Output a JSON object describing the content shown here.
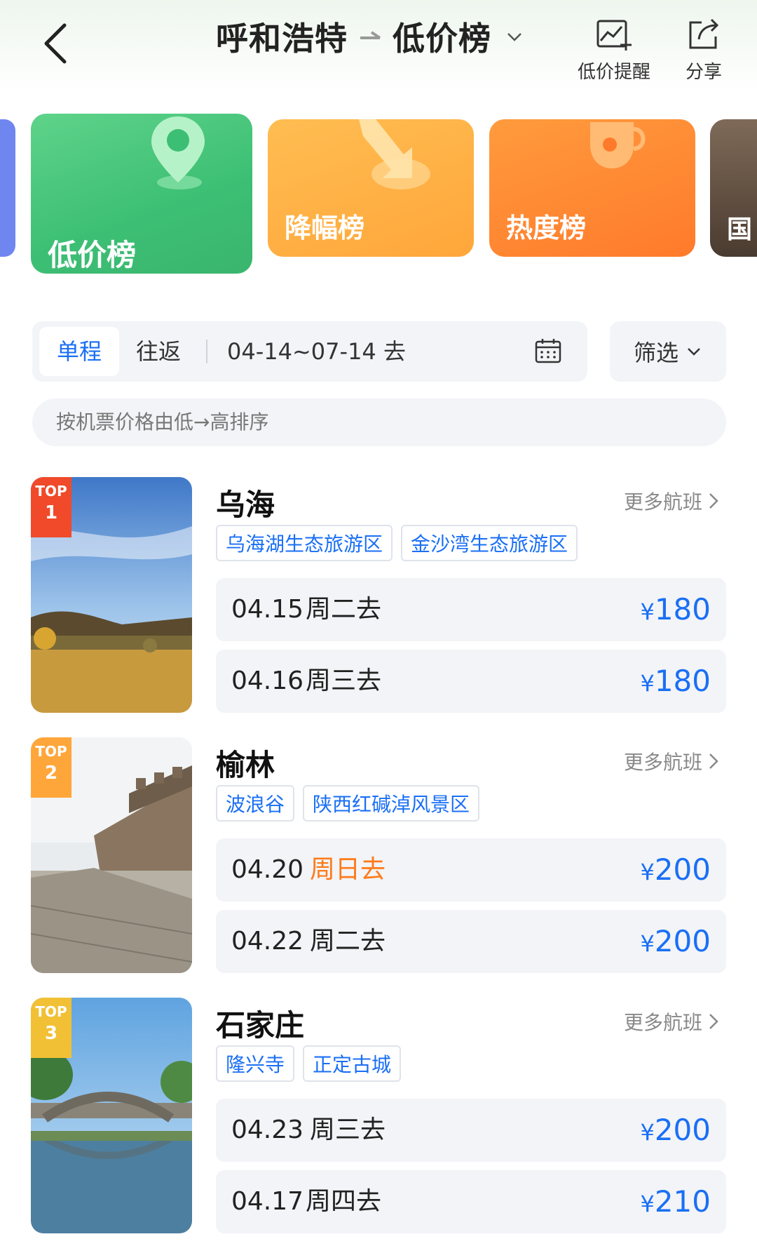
{
  "header": {
    "title_origin": "呼和浩特",
    "title_list": "低价榜",
    "action_alert": "低价提醒",
    "action_share": "分享"
  },
  "categories": [
    {
      "label": "低价榜",
      "active": true
    },
    {
      "label": "降幅榜"
    },
    {
      "label": "热度榜"
    },
    {
      "label": "国"
    }
  ],
  "filter": {
    "one_way": "单程",
    "round_trip": "往返",
    "date_range": "04-14~07-14 去",
    "filter_label": "筛选"
  },
  "sort_hint": "按机票价格由低→高排序",
  "colors": {
    "accent": "#1a6ff5",
    "weekend": "#ff7a1a",
    "top1": "#f04a2a",
    "top_other": "#ffa63a"
  },
  "ranks": [
    {
      "badge_top": "TOP",
      "badge_num": "1",
      "city": "乌海",
      "more": "更多航班",
      "tags": [
        "乌海湖生态旅游区",
        "金沙湾生态旅游区"
      ],
      "fares": [
        {
          "date": "04.15",
          "weekday": "周二去",
          "price": "180"
        },
        {
          "date": "04.16",
          "weekday": "周三去",
          "price": "180"
        }
      ]
    },
    {
      "badge_top": "TOP",
      "badge_num": "2",
      "city": "榆林",
      "more": "更多航班",
      "tags": [
        "波浪谷",
        "陕西红碱淖风景区"
      ],
      "fares": [
        {
          "date": "04.20",
          "weekday": "周日去",
          "price": "200"
        },
        {
          "date": "04.22",
          "weekday": "周二去",
          "price": "200"
        }
      ]
    },
    {
      "badge_top": "TOP",
      "badge_num": "3",
      "city": "石家庄",
      "more": "更多航班",
      "tags": [
        "隆兴寺",
        "正定古城"
      ],
      "fares": [
        {
          "date": "04.23",
          "weekday": "周三去",
          "price": "200"
        },
        {
          "date": "04.17",
          "weekday": "周四去",
          "price": "210"
        }
      ]
    }
  ],
  "currency": "¥"
}
